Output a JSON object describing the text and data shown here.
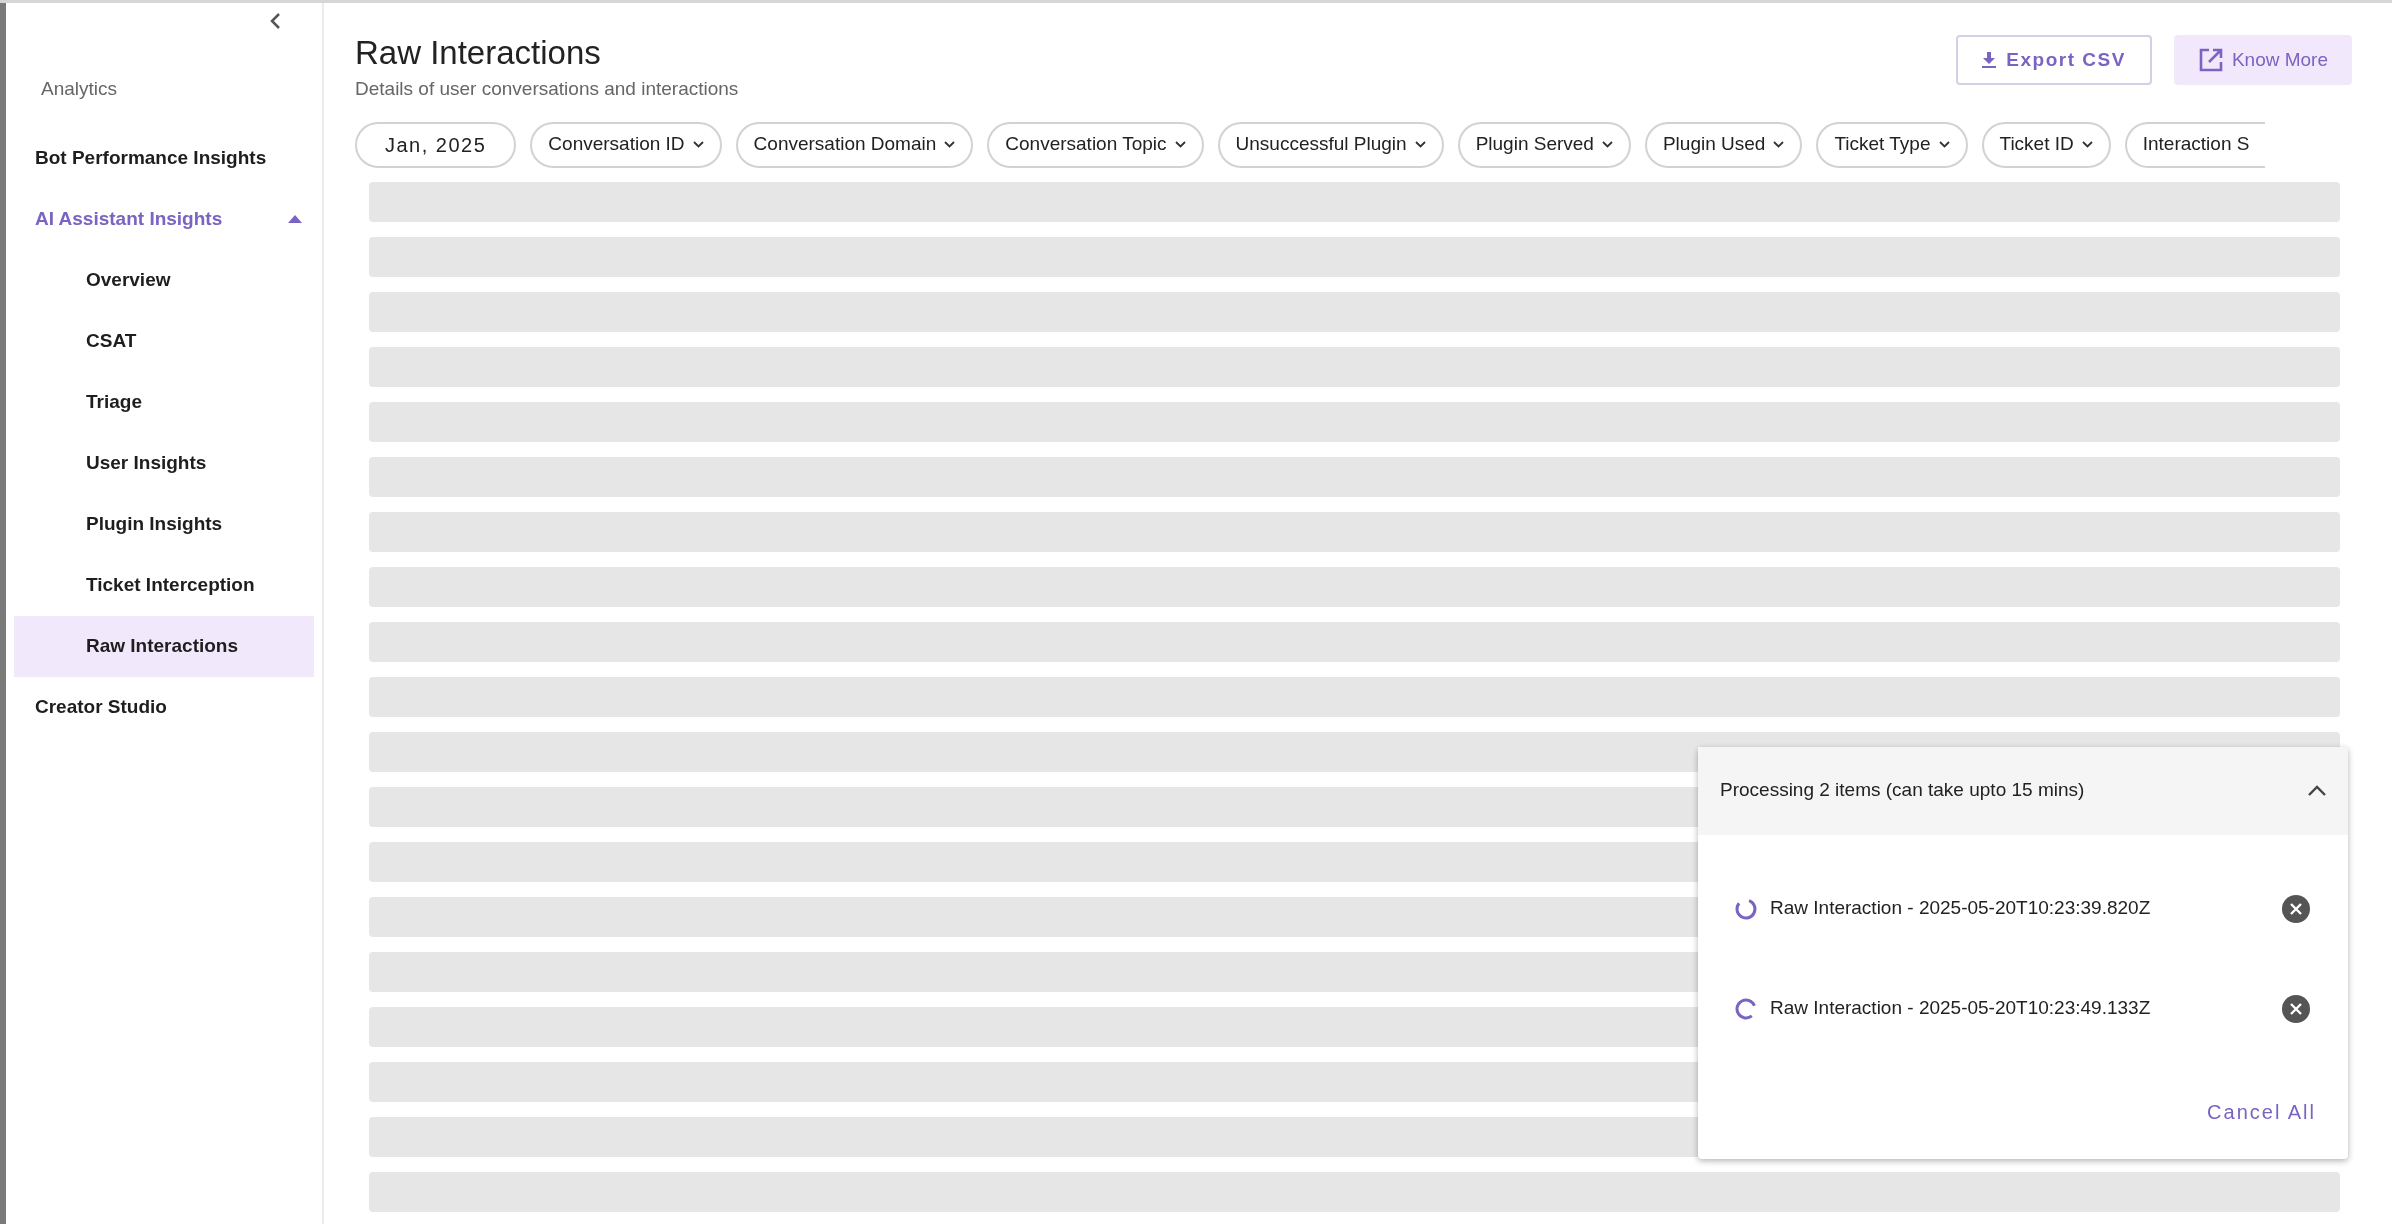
{
  "sidebar": {
    "section_label": "Analytics",
    "items": [
      {
        "label": "Bot Performance Insights",
        "selected": false,
        "expanded": false
      },
      {
        "label": "AI Assistant Insights",
        "selected": false,
        "expanded": true,
        "children": [
          {
            "label": "Overview",
            "selected": false
          },
          {
            "label": "CSAT",
            "selected": false
          },
          {
            "label": "Triage",
            "selected": false
          },
          {
            "label": "User Insights",
            "selected": false
          },
          {
            "label": "Plugin Insights",
            "selected": false
          },
          {
            "label": "Ticket Interception",
            "selected": false
          },
          {
            "label": "Raw Interactions",
            "selected": true
          }
        ]
      },
      {
        "label": "Creator Studio",
        "selected": false,
        "expanded": false
      }
    ]
  },
  "header": {
    "title": "Raw Interactions",
    "subtitle": "Details of user conversations and interactions",
    "buttons": [
      {
        "kind": "outline",
        "label": "Export CSV"
      },
      {
        "kind": "tonal",
        "label": "Know More"
      }
    ]
  },
  "filters": [
    {
      "kind": "date",
      "label": "Jan, 2025"
    },
    {
      "kind": "dropdown",
      "label": "Conversation ID"
    },
    {
      "kind": "dropdown",
      "label": "Conversation Domain"
    },
    {
      "kind": "dropdown",
      "label": "Conversation Topic"
    },
    {
      "kind": "dropdown",
      "label": "Unsuccessful Plugin"
    },
    {
      "kind": "dropdown",
      "label": "Plugin Served"
    },
    {
      "kind": "dropdown",
      "label": "Plugin Used"
    },
    {
      "kind": "dropdown",
      "label": "Ticket Type"
    },
    {
      "kind": "dropdown",
      "label": "Ticket ID"
    },
    {
      "kind": "cut",
      "label": "Interaction S"
    }
  ],
  "table": {
    "loading": true
  },
  "processing_panel": {
    "title": "Processing 2 items (can take upto 15 mins)",
    "expanded": true,
    "items": [
      {
        "label": "Raw Interaction - 2025-05-20T10:23:39.820Z"
      },
      {
        "label": "Raw Interaction - 2025-05-20T10:23:49.133Z"
      }
    ],
    "cancel_all": "Cancel All"
  }
}
